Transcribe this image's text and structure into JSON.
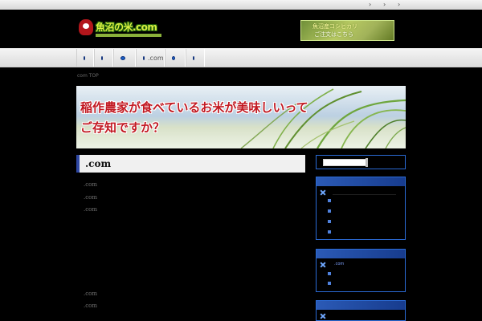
{
  "nav": {
    "items": [
      "",
      "",
      "",
      ".com",
      "",
      ""
    ]
  },
  "breadcrumb": "com TOP",
  "banner": {
    "line1": "稲作農家が食べているお米が美味しいって",
    "line2": "ご存知ですか？"
  },
  "logo": {
    "title": "魚沼の米.com"
  },
  "ad": {
    "line1": "魚沼産コシヒカリ",
    "line2": "ご注文はこちら"
  },
  "main": {
    "title": ".com",
    "lines": [
      ".com",
      ".com",
      ".com",
      ".com",
      ".com"
    ]
  },
  "sidebar": {
    "box1_items": [
      "",
      "",
      "",
      ""
    ],
    "box2_items": [
      ".com",
      "",
      ""
    ]
  }
}
